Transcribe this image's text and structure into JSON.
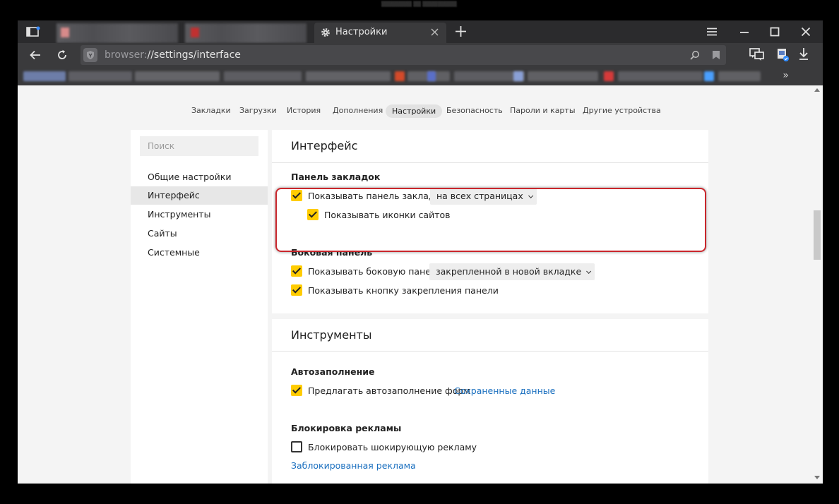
{
  "window": {
    "tab_title": "Настройки",
    "url_scheme": "browser:",
    "url_path": "//settings/interface"
  },
  "icons": {
    "tabs": "tabs-overview-icon",
    "gear": "gear-icon",
    "close": "close-icon",
    "new_tab": "plus-icon",
    "menu": "hamburger-menu-icon",
    "minimize": "minimize-icon",
    "maximize": "maximize-icon",
    "window_close": "window-close-icon",
    "back": "back-arrow-icon",
    "reload": "reload-icon",
    "protect": "shield-icon",
    "search": "search-icon",
    "bookmark": "bookmark-icon",
    "chat": "chat-icon",
    "extension": "extension-icon",
    "download": "download-icon",
    "more": "»"
  },
  "colors": {
    "checkbox_on": "#ffcc00",
    "link": "#1a6fbf",
    "highlight": "#c9262c"
  },
  "topnav": [
    "Закладки",
    "Загрузки",
    "История",
    "Дополнения",
    "Настройки",
    "Безопасность",
    "Пароли и карты",
    "Другие устройства"
  ],
  "sidebar": {
    "search_placeholder": "Поиск",
    "items": [
      "Общие настройки",
      "Интерфейс",
      "Инструменты",
      "Сайты",
      "Системные"
    ]
  },
  "interface_card": {
    "title": "Интерфейс",
    "bookmarks_panel": {
      "heading": "Панель закладок",
      "show_bar_label": "Показывать панель закладок",
      "show_bar_option": "на всех страницах",
      "show_icons_label": "Показывать иконки сайтов"
    },
    "side_panel": {
      "heading": "Боковая панель",
      "show_panel_label": "Показывать боковую панель",
      "show_panel_option": "закрепленной в новой вкладке",
      "pin_button_label": "Показывать кнопку закрепления панели"
    }
  },
  "tools_card": {
    "title": "Инструменты",
    "autofill": {
      "heading": "Автозаполнение",
      "offer_label": "Предлагать автозаполнение форм",
      "saved_link": "Сохраненные данные"
    },
    "ads": {
      "heading": "Блокировка рекламы",
      "block_label": "Блокировать шокирующую рекламу",
      "blocked_link": "Заблокированная реклама"
    }
  }
}
